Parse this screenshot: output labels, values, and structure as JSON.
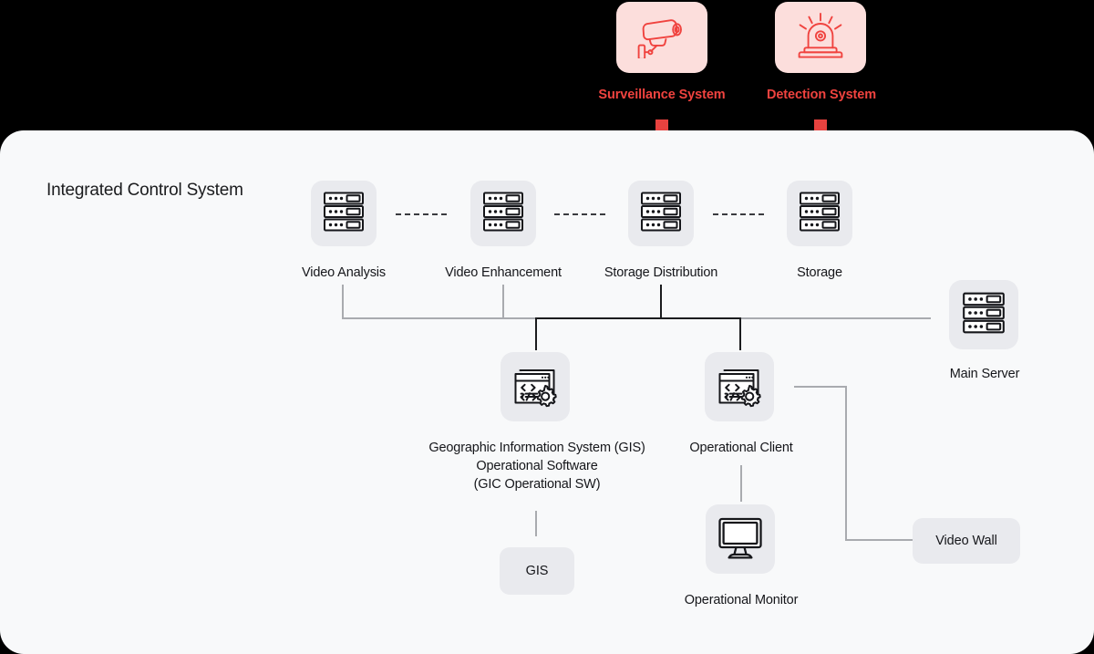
{
  "colors": {
    "background": "#000000",
    "panel": "#f8f9fa",
    "tile": "#e9eaee",
    "accent_red": "#f0433f",
    "accent_red_tile": "#fcdedc",
    "arrow_red": "#e8423f",
    "line_gray": "#a9abaf",
    "line_dark": "#1b1c1e",
    "text": "#15161a"
  },
  "external_systems": [
    {
      "id": "surveillance",
      "label": "Surveillance System",
      "icon": "cctv-camera-icon"
    },
    {
      "id": "detection",
      "label": "Detection System",
      "icon": "alarm-beacon-icon"
    }
  ],
  "panel": {
    "title": "Integrated Control System"
  },
  "server_row": {
    "connector_style": "dashed",
    "nodes": [
      {
        "id": "video-analysis",
        "label": "Video Analysis",
        "icon": "server-rack-icon"
      },
      {
        "id": "video-enhancement",
        "label": "Video Enhancement",
        "icon": "server-rack-icon"
      },
      {
        "id": "storage-distribution",
        "label": "Storage Distribution",
        "icon": "server-rack-icon"
      },
      {
        "id": "storage",
        "label": "Storage",
        "icon": "server-rack-icon"
      }
    ]
  },
  "software_nodes": [
    {
      "id": "gis-operational-software",
      "label": "Geographic Information System (GIS)\nOperational Software\n(GIC Operational SW)",
      "icon": "code-window-gear-icon"
    },
    {
      "id": "operational-client",
      "label": "Operational Client",
      "icon": "code-window-gear-icon"
    },
    {
      "id": "operational-monitor",
      "label": "Operational Monitor",
      "icon": "desktop-monitor-icon"
    }
  ],
  "side_nodes": [
    {
      "id": "main-server",
      "label": "Main Server",
      "icon": "server-rack-icon"
    }
  ],
  "pills": [
    {
      "id": "gis",
      "label": "GIS"
    },
    {
      "id": "video-wall",
      "label": "Video Wall"
    }
  ]
}
